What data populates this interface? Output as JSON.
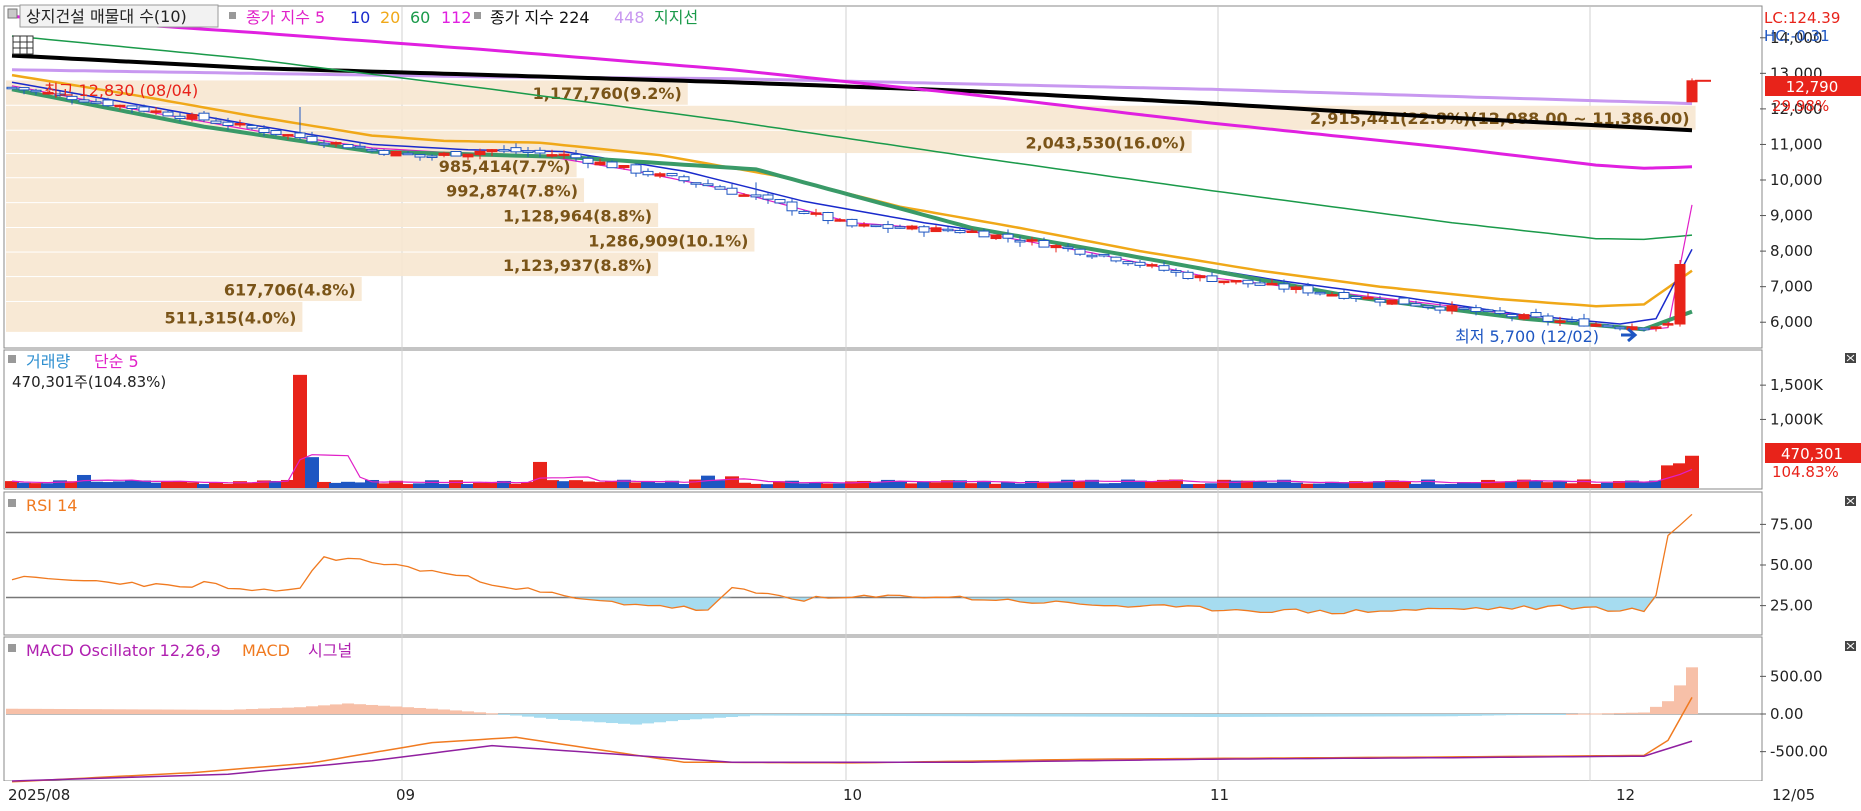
{
  "legend": {
    "stock_name": "상지건설 매물대 수(10)",
    "ma_label": "종가 지수 5",
    "ma_10": "10",
    "ma_20": "20",
    "ma_60": "60",
    "ma_112": "112",
    "ma224_label": "종가 지수 224",
    "ma_448": "448",
    "support_label": "지지선"
  },
  "colors": {
    "up": "#e8231a",
    "down": "#1e56c2",
    "ma5": "#e020c8",
    "ma10": "#1a2acc",
    "ma20": "#f0a818",
    "ma60": "#1a9a4a",
    "ma112": "#e020e0",
    "ma224": "#000000",
    "ma448": "#c898f0",
    "support": "#3a9a68",
    "profile": "#f7e7d0",
    "profile_text": "#7a5418"
  },
  "price_panel": {
    "lc": "LC:124.39",
    "hc": "HC:-0.31",
    "current_price": "12,790",
    "current_pct": "29.98%",
    "high_label": "최고 12,830 (08/04)",
    "low_label": "최저 5,700 (12/02)",
    "range_label": "2,915,441(22.8%)(12,088.00 ~ 11,386.00)",
    "axis_ticks": [
      "14,000",
      "13,000",
      "12,000",
      "11,000",
      "10,000",
      "9,000",
      "8,000",
      "7,000",
      "6,000"
    ]
  },
  "volume_panel": {
    "title_a": "거래량",
    "title_b": "단순 5",
    "value_label": "470,301주(104.83%)",
    "badge_value": "470,301",
    "badge_pct": "104.83%",
    "axis_ticks": [
      "1,500K",
      "1,000K"
    ]
  },
  "rsi_panel": {
    "title": "RSI 14",
    "axis_ticks": [
      "75.00",
      "50.00",
      "25.00"
    ]
  },
  "macd_panel": {
    "title_a": "MACD Oscillator 12,26,9",
    "title_b": "MACD",
    "title_c": "시그널",
    "axis_ticks": [
      "500.00",
      "0.00",
      "-500.00"
    ]
  },
  "x_axis": {
    "labels": [
      "2025/08",
      "09",
      "10",
      "11",
      "12"
    ],
    "right_label": "12/05"
  },
  "chart_data": {
    "type": "candlestick",
    "x_label_dates": [
      "2025/08",
      "09",
      "10",
      "11",
      "12"
    ],
    "price": {
      "last_close": 12790,
      "high": 12830,
      "high_date": "08/04",
      "low": 5700,
      "low_date": "12/02",
      "y_range": [
        5500,
        14500
      ],
      "anchors": [
        [
          0,
          12600
        ],
        [
          8,
          12150
        ],
        [
          16,
          11700
        ],
        [
          24,
          11200
        ],
        [
          30,
          10850
        ],
        [
          34,
          10650
        ],
        [
          40,
          10850
        ],
        [
          46,
          10700
        ],
        [
          52,
          10250
        ],
        [
          58,
          9850
        ],
        [
          64,
          9300
        ],
        [
          70,
          8700
        ],
        [
          74,
          8650
        ],
        [
          80,
          8550
        ],
        [
          86,
          8200
        ],
        [
          92,
          7800
        ],
        [
          98,
          7300
        ],
        [
          104,
          7050
        ],
        [
          110,
          6800
        ],
        [
          116,
          6550
        ],
        [
          122,
          6300
        ],
        [
          128,
          6050
        ],
        [
          134,
          5900
        ],
        [
          138,
          5900
        ],
        [
          139,
          7600
        ],
        [
          140,
          12790
        ]
      ],
      "ma_anchors": {
        "ma5": [
          [
            0,
            12650
          ],
          [
            10,
            12000
          ],
          [
            20,
            11400
          ],
          [
            30,
            10900
          ],
          [
            36,
            10780
          ],
          [
            44,
            10700
          ],
          [
            52,
            10250
          ],
          [
            60,
            9700
          ],
          [
            70,
            8800
          ],
          [
            80,
            8550
          ],
          [
            90,
            7950
          ],
          [
            100,
            7250
          ],
          [
            110,
            6850
          ],
          [
            120,
            6450
          ],
          [
            130,
            5980
          ],
          [
            136,
            5780
          ],
          [
            138,
            5850
          ],
          [
            140,
            9300
          ]
        ],
        "ma10": [
          [
            0,
            12750
          ],
          [
            10,
            12150
          ],
          [
            20,
            11550
          ],
          [
            30,
            11000
          ],
          [
            38,
            10850
          ],
          [
            46,
            10800
          ],
          [
            56,
            10250
          ],
          [
            66,
            9400
          ],
          [
            76,
            8800
          ],
          [
            86,
            8300
          ],
          [
            96,
            7700
          ],
          [
            106,
            7150
          ],
          [
            116,
            6700
          ],
          [
            126,
            6200
          ],
          [
            134,
            5950
          ],
          [
            137,
            6100
          ],
          [
            140,
            8050
          ]
        ],
        "ma20": [
          [
            0,
            12950
          ],
          [
            10,
            12400
          ],
          [
            20,
            11800
          ],
          [
            30,
            11250
          ],
          [
            36,
            11100
          ],
          [
            44,
            11050
          ],
          [
            54,
            10700
          ],
          [
            64,
            10100
          ],
          [
            74,
            9250
          ],
          [
            84,
            8650
          ],
          [
            94,
            8000
          ],
          [
            104,
            7450
          ],
          [
            114,
            7000
          ],
          [
            124,
            6650
          ],
          [
            132,
            6450
          ],
          [
            136,
            6500
          ],
          [
            140,
            7450
          ]
        ],
        "ma60": [
          [
            0,
            14050
          ],
          [
            20,
            13400
          ],
          [
            40,
            12550
          ],
          [
            60,
            11650
          ],
          [
            80,
            10650
          ],
          [
            100,
            9700
          ],
          [
            120,
            8800
          ],
          [
            132,
            8350
          ],
          [
            136,
            8330
          ],
          [
            140,
            8450
          ]
        ],
        "ma112": [
          [
            0,
            14600
          ],
          [
            20,
            14150
          ],
          [
            40,
            13650
          ],
          [
            60,
            13100
          ],
          [
            80,
            12400
          ],
          [
            100,
            11600
          ],
          [
            120,
            10900
          ],
          [
            132,
            10420
          ],
          [
            136,
            10330
          ],
          [
            140,
            10370
          ]
        ],
        "ma224": [
          [
            0,
            13500
          ],
          [
            20,
            13150
          ],
          [
            40,
            12950
          ],
          [
            60,
            12750
          ],
          [
            80,
            12500
          ],
          [
            100,
            12150
          ],
          [
            120,
            11750
          ],
          [
            140,
            11400
          ]
        ],
        "ma448": [
          [
            0,
            13100
          ],
          [
            20,
            13000
          ],
          [
            40,
            12900
          ],
          [
            60,
            12850
          ],
          [
            80,
            12700
          ],
          [
            100,
            12550
          ],
          [
            120,
            12350
          ],
          [
            140,
            12150
          ]
        ],
        "support": [
          [
            0,
            12550
          ],
          [
            16,
            11500
          ],
          [
            30,
            10800
          ],
          [
            46,
            10650
          ],
          [
            62,
            10300
          ],
          [
            80,
            8650
          ],
          [
            96,
            7700
          ],
          [
            112,
            6700
          ],
          [
            126,
            6100
          ],
          [
            136,
            5800
          ],
          [
            140,
            6300
          ]
        ]
      },
      "volume_profile": [
        {
          "label": "2,915,441(22.8%)(12,088.00 ~ 11,386.00)",
          "low": 11386,
          "high": 12088,
          "pct": 22.8
        },
        {
          "label": "2,043,530(16.0%)",
          "low": 10730,
          "high": 11386,
          "pct": 16.0
        },
        {
          "label": "1,177,760(9.2%)",
          "low": 12088,
          "high": 12800,
          "pct": 9.2
        },
        {
          "label": "985,414(7.7%)",
          "low": 10050,
          "high": 10730,
          "pct": 7.7
        },
        {
          "label": "992,874(7.8%)",
          "low": 9350,
          "high": 10050,
          "pct": 7.8
        },
        {
          "label": "1,128,964(8.8%)",
          "low": 8650,
          "high": 9350,
          "pct": 8.8
        },
        {
          "label": "1,286,909(10.1%)",
          "low": 7960,
          "high": 8650,
          "pct": 10.1
        },
        {
          "label": "1,123,937(8.8%)",
          "low": 7270,
          "high": 7960,
          "pct": 8.8
        },
        {
          "label": "617,706(4.8%)",
          "low": 6570,
          "high": 7270,
          "pct": 4.8
        },
        {
          "label": "511,315(4.0%)",
          "low": 5700,
          "high": 6570,
          "pct": 4.0
        }
      ]
    },
    "volume": {
      "y_range": [
        0,
        1750000
      ],
      "last": 470301,
      "last_pct": 104.83,
      "spikes": [
        [
          6,
          190000,
          "down"
        ],
        [
          24,
          1650000,
          "up"
        ],
        [
          25,
          450000,
          "down"
        ],
        [
          44,
          380000,
          "up"
        ],
        [
          58,
          180000,
          "down"
        ],
        [
          60,
          170000,
          "up"
        ],
        [
          138,
          330000,
          "up"
        ],
        [
          139,
          360000,
          "up"
        ],
        [
          140,
          470301,
          "up"
        ]
      ]
    },
    "rsi": {
      "y_range": [
        10,
        90
      ],
      "levels": [
        70,
        30
      ],
      "anchors": [
        [
          0,
          42
        ],
        [
          10,
          39
        ],
        [
          14,
          36
        ],
        [
          16,
          39
        ],
        [
          20,
          33
        ],
        [
          24,
          36
        ],
        [
          26,
          55
        ],
        [
          30,
          52
        ],
        [
          36,
          45
        ],
        [
          42,
          36
        ],
        [
          48,
          28
        ],
        [
          54,
          25
        ],
        [
          58,
          22
        ],
        [
          60,
          35
        ],
        [
          66,
          29
        ],
        [
          76,
          31
        ],
        [
          86,
          27
        ],
        [
          92,
          25
        ],
        [
          100,
          23
        ],
        [
          110,
          21
        ],
        [
          120,
          23
        ],
        [
          130,
          24
        ],
        [
          136,
          22
        ],
        [
          137,
          30
        ],
        [
          138,
          68
        ],
        [
          140,
          82
        ]
      ]
    },
    "macd": {
      "y_range": [
        -850,
        850
      ],
      "osc_anchors": [
        [
          0,
          70
        ],
        [
          18,
          55
        ],
        [
          24,
          90
        ],
        [
          28,
          140
        ],
        [
          36,
          60
        ],
        [
          40,
          10
        ],
        [
          46,
          -80
        ],
        [
          52,
          -140
        ],
        [
          56,
          -80
        ],
        [
          62,
          -20
        ],
        [
          80,
          -30
        ],
        [
          100,
          -40
        ],
        [
          120,
          -30
        ],
        [
          136,
          20
        ],
        [
          138,
          170
        ],
        [
          139,
          380
        ],
        [
          140,
          620
        ]
      ],
      "macd_anchors": [
        [
          0,
          -900
        ],
        [
          15,
          -780
        ],
        [
          25,
          -650
        ],
        [
          35,
          -380
        ],
        [
          42,
          -310
        ],
        [
          50,
          -500
        ],
        [
          56,
          -640
        ],
        [
          70,
          -650
        ],
        [
          90,
          -600
        ],
        [
          120,
          -570
        ],
        [
          136,
          -550
        ],
        [
          138,
          -350
        ],
        [
          140,
          220
        ]
      ],
      "signal_anchors": [
        [
          0,
          -890
        ],
        [
          18,
          -800
        ],
        [
          30,
          -620
        ],
        [
          40,
          -420
        ],
        [
          50,
          -530
        ],
        [
          60,
          -640
        ],
        [
          80,
          -640
        ],
        [
          100,
          -600
        ],
        [
          120,
          -580
        ],
        [
          136,
          -560
        ],
        [
          140,
          -360
        ]
      ]
    }
  }
}
